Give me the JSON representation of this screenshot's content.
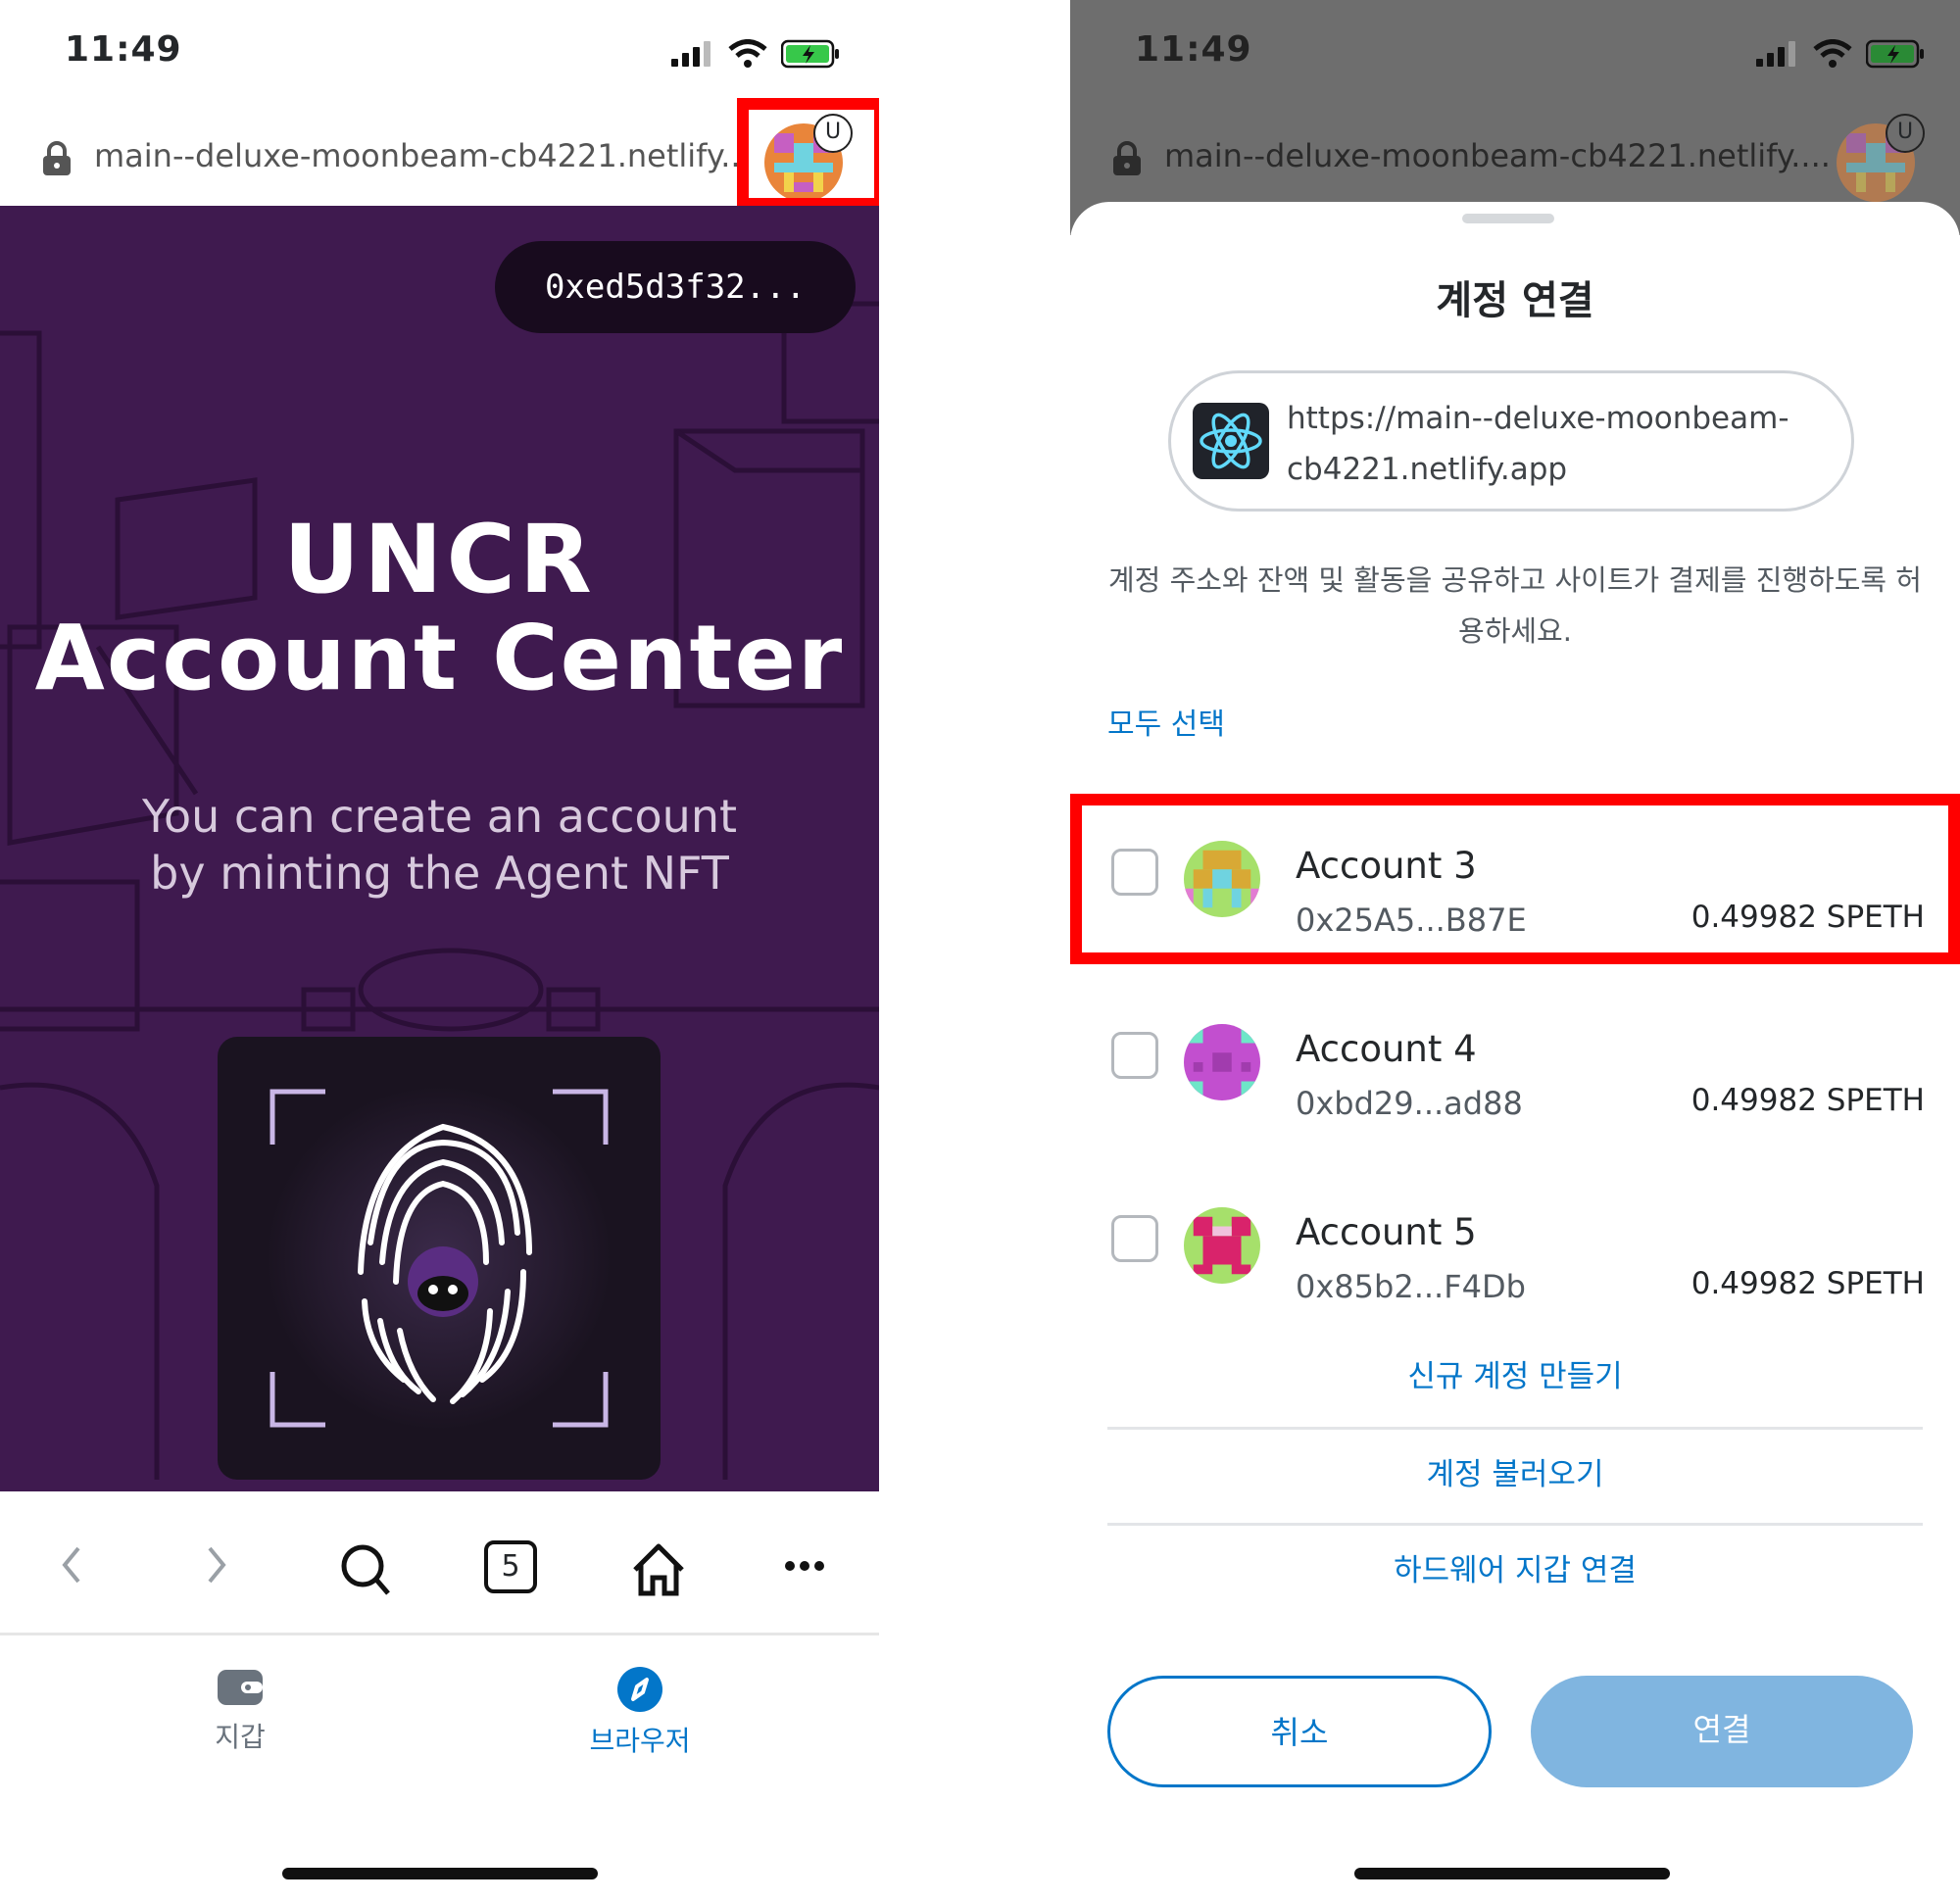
{
  "left": {
    "status": {
      "time": "11:49"
    },
    "url": "main--deluxe-moonbeam-cb4221.netlify...",
    "avatar_badge": "U",
    "wallet_button": "0xed5d3f32...",
    "hero": {
      "title_line1": "UNCR",
      "title_line2": "Account Center",
      "subtitle_line1": "You can create an account",
      "subtitle_line2": "by minting the Agent NFT"
    },
    "nav": {
      "tab_count": "5"
    },
    "tabs": [
      {
        "label": "지갑"
      },
      {
        "label": "브라우저"
      }
    ]
  },
  "right": {
    "status": {
      "time": "11:49"
    },
    "url": "main--deluxe-moonbeam-cb4221.netlify....",
    "avatar_badge": "U",
    "title": "계정 연결",
    "site_url_line1": "https://main--deluxe-moonbeam-",
    "site_url_line2": "cb4221.netlify.app",
    "permission_text": "계정 주소와 잔액 및 활동을 공유하고 사이트가 결제를 진행하도록 허용하세요.",
    "select_all": "모두 선택",
    "accounts": [
      {
        "name": "Account 3",
        "address": "0x25A5...B87E",
        "balance": "0.49982 SPETH"
      },
      {
        "name": "Account 4",
        "address": "0xbd29...ad88",
        "balance": "0.49982 SPETH"
      },
      {
        "name": "Account 5",
        "address": "0x85b2...F4Db",
        "balance": "0.49982 SPETH"
      }
    ],
    "actions": {
      "create_account": "신규 계정 만들기",
      "import_account": "계정 불러오기",
      "hardware_wallet": "하드웨어 지갑 연결"
    },
    "buttons": {
      "cancel": "취소",
      "connect": "연결"
    }
  },
  "colors": {
    "accent": "#0376c9",
    "hero_bg": "#3f1a4f",
    "highlight": "#ff0000",
    "connect_disabled": "#80b5e0"
  }
}
